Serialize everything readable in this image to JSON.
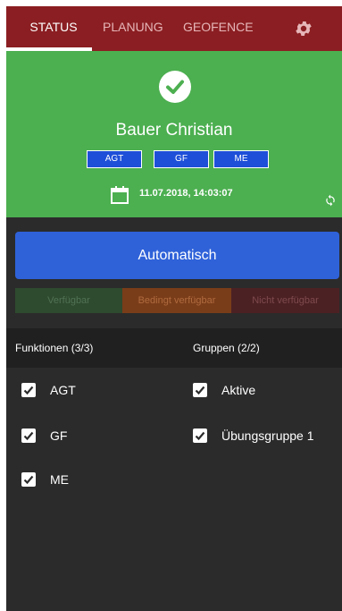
{
  "tabs": [
    {
      "label": "STATUS",
      "active": true
    },
    {
      "label": "PLANUNG",
      "active": false
    },
    {
      "label": "GEOFENCE",
      "active": false
    }
  ],
  "status": {
    "name": "Bauer Christian",
    "badges": [
      "AGT",
      "GF",
      "ME"
    ],
    "datetime": "11.07.2018, 14:03:07"
  },
  "auto_button": "Automatisch",
  "availability": {
    "options": [
      "Verfügbar",
      "Bedingt verfügbar",
      "Nicht verfügbar"
    ]
  },
  "functions": {
    "title": "Funktionen (3/3)",
    "items": [
      {
        "label": "AGT",
        "checked": true
      },
      {
        "label": "GF",
        "checked": true
      },
      {
        "label": "ME",
        "checked": true
      }
    ]
  },
  "groups": {
    "title": "Gruppen (2/2)",
    "items": [
      {
        "label": "Aktive",
        "checked": true
      },
      {
        "label": "Übungsgruppe 1",
        "checked": true
      }
    ]
  },
  "colors": {
    "header": "#8b1e22",
    "status_panel": "#4caf50",
    "primary_button": "#2f62d9",
    "background": "#2b2b2b"
  }
}
